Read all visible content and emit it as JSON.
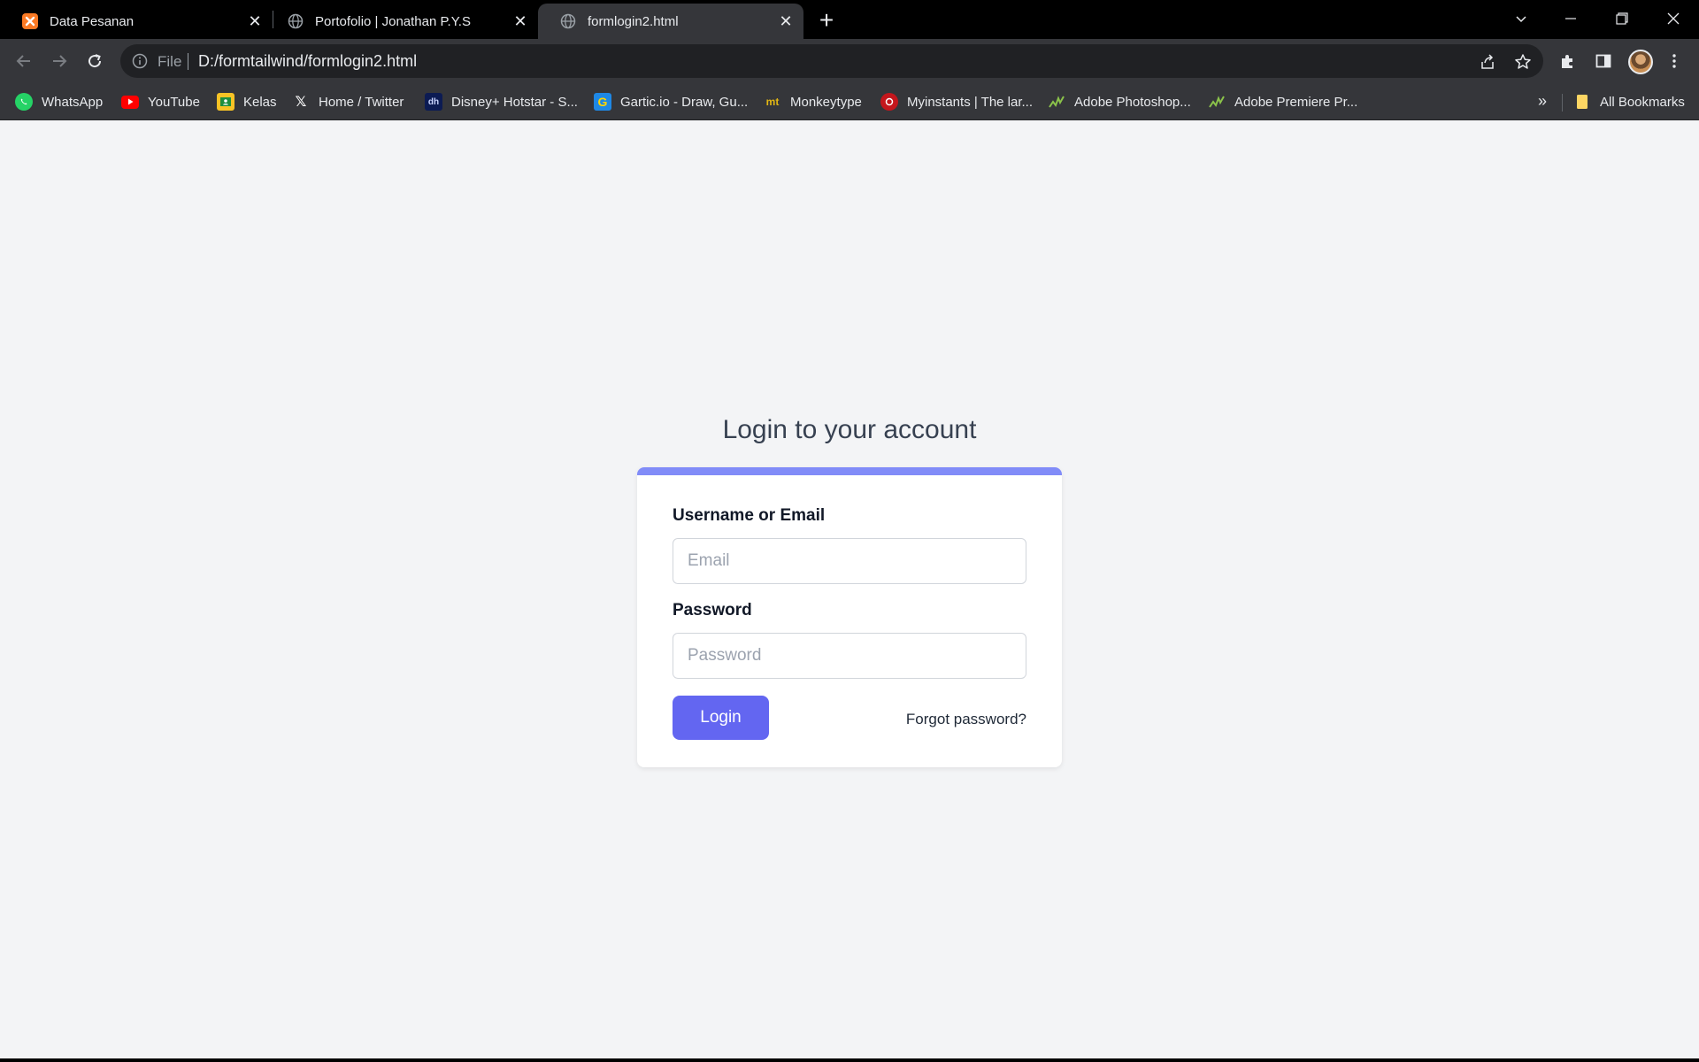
{
  "browser": {
    "tabs": [
      {
        "title": "Data Pesanan",
        "icon": "xampp-icon",
        "active": false
      },
      {
        "title": "Portofolio | Jonathan P.Y.S",
        "icon": "globe-icon",
        "active": false
      },
      {
        "title": "formlogin2.html",
        "icon": "globe-icon",
        "active": true
      }
    ],
    "address": {
      "scheme": "File",
      "url": "D:/formtailwind/formlogin2.html"
    },
    "bookmarks": [
      {
        "label": "WhatsApp",
        "icon": "whatsapp-icon"
      },
      {
        "label": "YouTube",
        "icon": "youtube-icon"
      },
      {
        "label": "Kelas",
        "icon": "classroom-icon"
      },
      {
        "label": "Home / Twitter",
        "icon": "x-icon"
      },
      {
        "label": "Disney+ Hotstar - S...",
        "icon": "hotstar-icon"
      },
      {
        "label": "Gartic.io - Draw, Gu...",
        "icon": "gartic-icon"
      },
      {
        "label": "Monkeytype",
        "icon": "monkeytype-icon"
      },
      {
        "label": "Myinstants | The lar...",
        "icon": "myinstants-icon"
      },
      {
        "label": "Adobe Photoshop...",
        "icon": "adobe-icon"
      },
      {
        "label": "Adobe Premiere Pr...",
        "icon": "adobe-icon"
      }
    ],
    "more_bookmarks": "»",
    "all_bookmarks": "All Bookmarks"
  },
  "page": {
    "heading": "Login to your account",
    "username_label": "Username or Email",
    "username_placeholder": "Email",
    "password_label": "Password",
    "password_placeholder": "Password",
    "login_button": "Login",
    "forgot_link": "Forgot password?"
  },
  "colors": {
    "accent": "#6366f1",
    "card_top_bar": "#818cf8",
    "page_background": "#f3f4f6"
  }
}
